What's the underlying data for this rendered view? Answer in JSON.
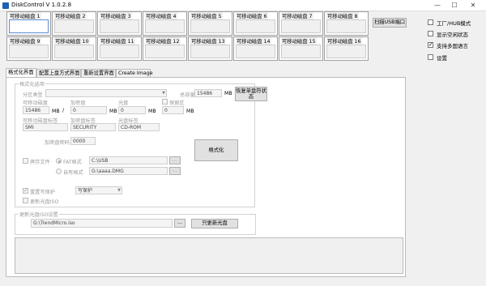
{
  "window": {
    "title": "DiskControl V 1.0.2.8",
    "minimize": "—",
    "maximize": "☐",
    "close": "✕"
  },
  "disks": [
    {
      "label": "可移动磁盘 1"
    },
    {
      "label": "可移动磁盘 2"
    },
    {
      "label": "可移动磁盘 3"
    },
    {
      "label": "可移动磁盘 4"
    },
    {
      "label": "可移动磁盘 5"
    },
    {
      "label": "可移动磁盘 6"
    },
    {
      "label": "可移动磁盘 7"
    },
    {
      "label": "可移动磁盘 8"
    },
    {
      "label": "可移动磁盘 9"
    },
    {
      "label": "可移动磁盘 10"
    },
    {
      "label": "可移动磁盘 11"
    },
    {
      "label": "可移动磁盘 12"
    },
    {
      "label": "可移动磁盘 13"
    },
    {
      "label": "可移动磁盘 14"
    },
    {
      "label": "可移动磁盘 15"
    },
    {
      "label": "可移动磁盘 16"
    }
  ],
  "scan_button": "扫描USB端口",
  "side_options": [
    {
      "label": "工厂/HUB模式",
      "checked": false
    },
    {
      "label": "显示空闲状态",
      "checked": false
    },
    {
      "label": "支持多国语言",
      "checked": true
    },
    {
      "label": "设置",
      "checked": false
    }
  ],
  "tabs": [
    "格式化界面",
    "配置上盘方式界面",
    "重新设置界面",
    "Create Image"
  ],
  "format_options": {
    "group_label": "格式化选项",
    "partition_type_label": "分区类型",
    "partition_type_value": "",
    "total_capacity_label": "总容量",
    "total_capacity_value": "15486",
    "total_capacity_unit": "MB",
    "restore_button": "恢复单盘符状态",
    "removable_disk_label": "可移动磁盘",
    "removable_disk_value": "15486",
    "removable_disk_unit": "MB",
    "separator": "/",
    "encrypted_disk_label": "加密盘",
    "encrypted_disk_value": "0",
    "encrypted_disk_unit": "MB",
    "cd_label": "光盘",
    "cd_value": "0",
    "cd_unit": "MB",
    "cache_area_label": "保留区",
    "cache_area_value": "0",
    "cache_area_unit": "MB",
    "removable_tag_label": "可移动磁盘标签",
    "removable_tag_value": "SMI",
    "encrypted_tag_label": "加密盘标签",
    "encrypted_tag_value": "SECURITY",
    "cd_tag_label": "光盘标签",
    "cd_tag_value": "CD-ROM",
    "password_label": "加密盘密码",
    "password_value": "0000",
    "format_button": "格式化",
    "keep_file_label": "拷存文件",
    "fat_format_label": "FAT格式",
    "fat_path": "C:\\USB",
    "fat_browse": "...",
    "own_format_label": "自有格式",
    "own_path": "G:\\aaaa.DMG",
    "own_browse": "...",
    "reset_write_protect_label": "重置写保护",
    "write_protect_value": "写保护",
    "update_cd_iso_label": "更新光盘ISO"
  },
  "iso_update": {
    "group_label": "更新光盘ISO设置",
    "iso_path": "G:\\TrendMicro.iso",
    "browse": "...",
    "update_button": "只更新光盘"
  }
}
